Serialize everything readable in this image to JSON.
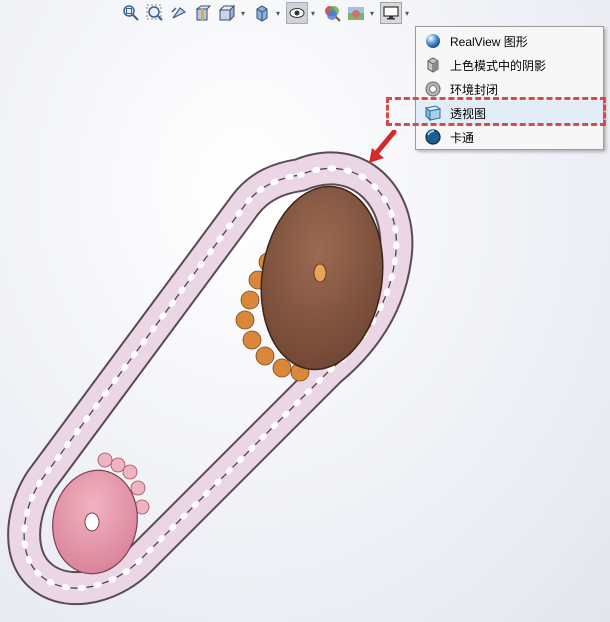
{
  "toolbar": {
    "buttons": [
      {
        "name": "zoom-to-fit-icon"
      },
      {
        "name": "zoom-to-area-icon"
      },
      {
        "name": "previous-view-icon"
      },
      {
        "name": "section-view-icon"
      },
      {
        "name": "view-orientation-icon"
      },
      {
        "name": "display-style-icon"
      },
      {
        "name": "hide-show-items-icon"
      },
      {
        "name": "edit-appearance-icon"
      },
      {
        "name": "apply-scene-icon"
      },
      {
        "name": "view-settings-icon"
      }
    ]
  },
  "menu": {
    "items": [
      {
        "label": "RealView 图形",
        "icon": "realview-sphere-icon"
      },
      {
        "label": "上色模式中的阴影",
        "icon": "shadow-cube-icon"
      },
      {
        "label": "环境封闭",
        "icon": "ambient-occlusion-icon"
      },
      {
        "label": "透视图",
        "icon": "perspective-cube-icon",
        "highlighted": true
      },
      {
        "label": "卡通",
        "icon": "cartoon-sphere-icon"
      }
    ]
  },
  "colors": {
    "annotation_red": "#d84a4a",
    "large_sprocket": "#8a5a44",
    "small_sprocket": "#e59aae",
    "chain_link": "#ead6e4"
  }
}
